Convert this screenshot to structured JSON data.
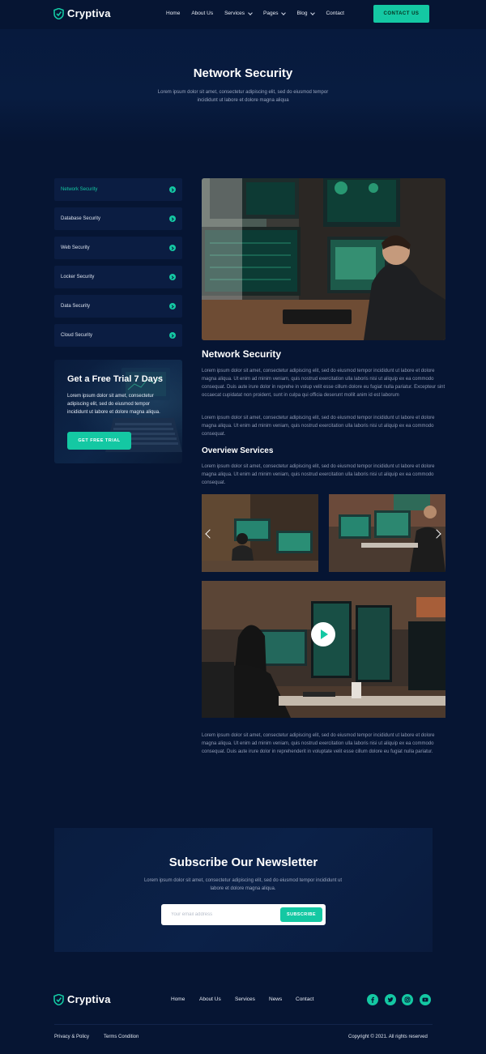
{
  "brand": {
    "name": "Cryptiva",
    "accent": "#14c8a3",
    "background": "#061533"
  },
  "header": {
    "nav": [
      {
        "label": "Home",
        "has_dropdown": false
      },
      {
        "label": "About Us",
        "has_dropdown": false
      },
      {
        "label": "Services",
        "has_dropdown": true
      },
      {
        "label": "Pages",
        "has_dropdown": true
      },
      {
        "label": "Blog",
        "has_dropdown": true
      },
      {
        "label": "Contact",
        "has_dropdown": false
      }
    ],
    "cta_label": "CONTACT US"
  },
  "hero": {
    "title": "Network Security",
    "subtitle": "Lorem ipsum dolor sit amet, consectetur adipiscing elit, sed do eiusmod tempor incididunt ut labore et dolore magna aliqua"
  },
  "sidebar": {
    "items": [
      {
        "label": "Network Security",
        "active": true
      },
      {
        "label": "Database Security",
        "active": false
      },
      {
        "label": "Web Security",
        "active": false
      },
      {
        "label": "Locker Security",
        "active": false
      },
      {
        "label": "Data Security",
        "active": false
      },
      {
        "label": "Cloud Security",
        "active": false
      }
    ],
    "item_icon": "arrow-right-circle-icon",
    "trial": {
      "title": "Get a Free Trial 7 Days",
      "text": "Lorem ipsum dolor sit amet, consectetur adipiscing elit, sed do eiusmod tempor incididunt ut labore et dolore magna aliqua.",
      "button": "GET FREE TRIAL"
    }
  },
  "main": {
    "title": "Network Security",
    "para1": "Lorem ipsum dolor sit amet, consectetur adipiscing elit, sed do eiusmod tempor incididunt ut labore et dolore magna aliqua. Ut enim ad minim veniam, quis nostrud exercitation ulla laboris nisi ut aliquip ex ea commodo consequat. Duis aute irure dolor in reprehe in volup velit esse cillum dolore eu fugiat nulla pariatur. Excepteur sint occaecat cupidatat non proident, sunt in culpa qui officia deserunt mollit anim id est laborum",
    "para2": "Lorem ipsum dolor sit amet, consectetur adipiscing elit, sed do eiusmod tempor incididunt ut labore et dolore magna aliqua. Ut enim ad minim veniam, quis nostrud exercitation ulla laboris nisi ut aliquip ex ea commodo consequat.",
    "overview_title": "Overview Services",
    "para3": "Lorem ipsum dolor sit amet, consectetur adipiscing elit, sed do eiusmod tempor incididunt ut labore et dolore magna aliqua. Ut enim ad minim veniam, quis nostrud exercitation ulla laboris nisi ut aliquip ex ea commodo consequat.",
    "para4": "Lorem ipsum dolor sit amet, consectetur adipiscing elit, sed do eiusmod tempor incididunt ut labore et dolore magna aliqua. Ut enim ad minim veniam, quis nostrud exercitation ulla laboris nisi ut aliquip ex ea commodo consequat. Duis aute irure dolor in reprehenderit in voluptate velit esse cillum dolore eu fugiat nulla pariatur."
  },
  "newsletter": {
    "title": "Subscribe Our Newsletter",
    "subtitle": "Lorem ipsum dolor sit amet, consectetur adipiscing elit, sed do eiusmod tempor incididunt ut labore et dolore magna aliqua.",
    "placeholder": "Your email address",
    "button": "SUBSCRIBE"
  },
  "footer": {
    "nav": [
      "Home",
      "About Us",
      "Services",
      "News",
      "Contact"
    ],
    "social": [
      "facebook-icon",
      "twitter-icon",
      "instagram-icon",
      "youtube-icon"
    ],
    "links": [
      "Privacy & Policy",
      "Terms Condition"
    ],
    "copyright": "Copyright © 2021. All rights reserved"
  }
}
